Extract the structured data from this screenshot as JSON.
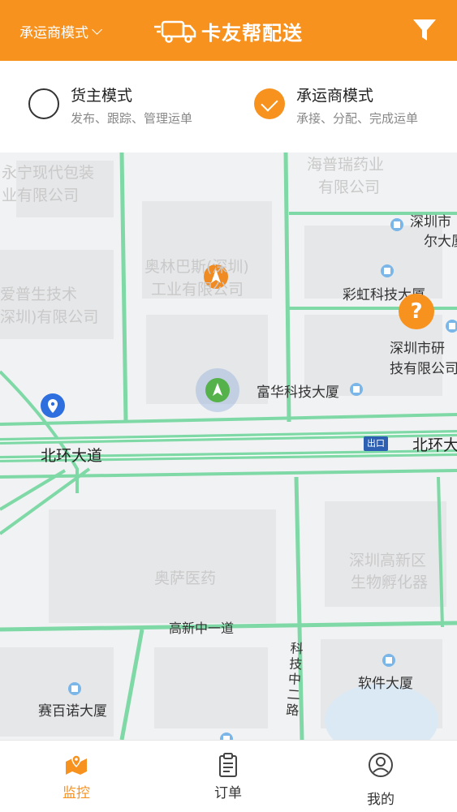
{
  "header": {
    "mode_select_label": "承运商模式",
    "app_title": "卡友帮配送"
  },
  "mode_options": [
    {
      "title": "货主模式",
      "subtitle": "发布、跟踪、管理运单",
      "selected": false
    },
    {
      "title": "承运商模式",
      "subtitle": "承接、分配、完成运单",
      "selected": true
    }
  ],
  "map": {
    "labels": {
      "yongning": "永宁现代包装",
      "yongning2": "业有限公司",
      "aipu": "爱普生技术",
      "aipu2": "深圳)有限公司",
      "haipurui": "海普瑞药业",
      "haipurui2": "有限公司",
      "olympus": "奥林巴斯(深圳)",
      "olympus2": "工业有限公司",
      "shenzhenshi": "深圳市",
      "shenzhenshi2": "尔大厦",
      "caihong": "彩虹科技大厦",
      "yanjiu": "深圳市研",
      "yanjiu2": "技有限公司",
      "fuhua": "富华科技大厦",
      "beihuan_left": "北环大道",
      "beihuan_right": "北环大",
      "exit": "出口",
      "aosa": "奥萨医药",
      "gaoxinqu": "深圳高新区",
      "gaoxinqu2": "生物孵化器",
      "gaoxinzhongyi": "高新中一道",
      "kejizhong": "科技中二路",
      "ruanjian": "软件大厦",
      "saibainuo": "赛百诺大厦"
    },
    "help_label": "?"
  },
  "tabbar": {
    "tabs": [
      {
        "label": "监控",
        "icon": "map-monitor-icon",
        "active": true
      },
      {
        "label": "订单",
        "icon": "clipboard-icon",
        "active": false
      },
      {
        "label": "我的",
        "icon": "user-icon",
        "active": false
      }
    ]
  },
  "colors": {
    "brand": "#f7921e",
    "road": "#7fd9a6",
    "map_bg": "#f1f2f3"
  }
}
